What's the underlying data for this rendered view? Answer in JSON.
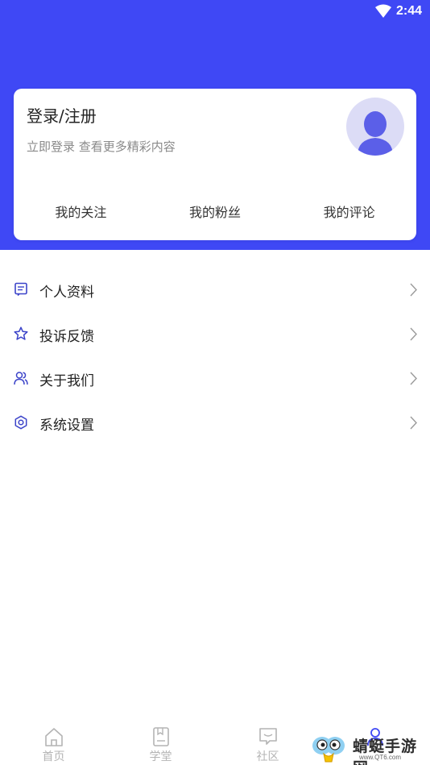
{
  "status_bar": {
    "time": "2:44"
  },
  "profile_card": {
    "title": "登录/注册",
    "subtitle": "立即登录 查看更多精彩内容",
    "stats": [
      {
        "label": "我的关注"
      },
      {
        "label": "我的粉丝"
      },
      {
        "label": "我的评论"
      }
    ]
  },
  "menu": [
    {
      "label": "个人资料",
      "icon": "document-icon"
    },
    {
      "label": "投诉反馈",
      "icon": "star-icon"
    },
    {
      "label": "关于我们",
      "icon": "users-icon"
    },
    {
      "label": "系统设置",
      "icon": "gear-icon"
    }
  ],
  "tab_bar": {
    "tabs": [
      {
        "label": "首页",
        "icon": "home-icon"
      },
      {
        "label": "学堂",
        "icon": "book-icon"
      },
      {
        "label": "社区",
        "icon": "chat-icon"
      },
      {
        "label": "",
        "icon": "user-icon",
        "active": true
      }
    ]
  },
  "watermark": {
    "text": "蜻蜓手游网",
    "url": "www.QT6.com"
  },
  "colors": {
    "accent": "#3f48f5",
    "icon_accent": "#3c44c9",
    "text_primary": "#222222",
    "text_secondary": "#8a8a8a",
    "tab_inactive": "#b4b4b4",
    "avatar_bg": "#dcdcf6",
    "avatar_fg": "#5b5fe8"
  }
}
